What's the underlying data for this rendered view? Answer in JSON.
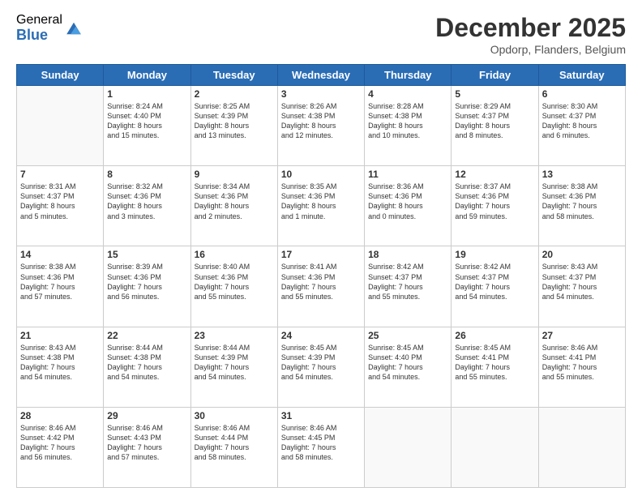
{
  "logo": {
    "general": "General",
    "blue": "Blue"
  },
  "title": "December 2025",
  "location": "Opdorp, Flanders, Belgium",
  "days_of_week": [
    "Sunday",
    "Monday",
    "Tuesday",
    "Wednesday",
    "Thursday",
    "Friday",
    "Saturday"
  ],
  "weeks": [
    [
      {
        "day": "",
        "info": ""
      },
      {
        "day": "1",
        "info": "Sunrise: 8:24 AM\nSunset: 4:40 PM\nDaylight: 8 hours\nand 15 minutes."
      },
      {
        "day": "2",
        "info": "Sunrise: 8:25 AM\nSunset: 4:39 PM\nDaylight: 8 hours\nand 13 minutes."
      },
      {
        "day": "3",
        "info": "Sunrise: 8:26 AM\nSunset: 4:38 PM\nDaylight: 8 hours\nand 12 minutes."
      },
      {
        "day": "4",
        "info": "Sunrise: 8:28 AM\nSunset: 4:38 PM\nDaylight: 8 hours\nand 10 minutes."
      },
      {
        "day": "5",
        "info": "Sunrise: 8:29 AM\nSunset: 4:37 PM\nDaylight: 8 hours\nand 8 minutes."
      },
      {
        "day": "6",
        "info": "Sunrise: 8:30 AM\nSunset: 4:37 PM\nDaylight: 8 hours\nand 6 minutes."
      }
    ],
    [
      {
        "day": "7",
        "info": "Sunrise: 8:31 AM\nSunset: 4:37 PM\nDaylight: 8 hours\nand 5 minutes."
      },
      {
        "day": "8",
        "info": "Sunrise: 8:32 AM\nSunset: 4:36 PM\nDaylight: 8 hours\nand 3 minutes."
      },
      {
        "day": "9",
        "info": "Sunrise: 8:34 AM\nSunset: 4:36 PM\nDaylight: 8 hours\nand 2 minutes."
      },
      {
        "day": "10",
        "info": "Sunrise: 8:35 AM\nSunset: 4:36 PM\nDaylight: 8 hours\nand 1 minute."
      },
      {
        "day": "11",
        "info": "Sunrise: 8:36 AM\nSunset: 4:36 PM\nDaylight: 8 hours\nand 0 minutes."
      },
      {
        "day": "12",
        "info": "Sunrise: 8:37 AM\nSunset: 4:36 PM\nDaylight: 7 hours\nand 59 minutes."
      },
      {
        "day": "13",
        "info": "Sunrise: 8:38 AM\nSunset: 4:36 PM\nDaylight: 7 hours\nand 58 minutes."
      }
    ],
    [
      {
        "day": "14",
        "info": "Sunrise: 8:38 AM\nSunset: 4:36 PM\nDaylight: 7 hours\nand 57 minutes."
      },
      {
        "day": "15",
        "info": "Sunrise: 8:39 AM\nSunset: 4:36 PM\nDaylight: 7 hours\nand 56 minutes."
      },
      {
        "day": "16",
        "info": "Sunrise: 8:40 AM\nSunset: 4:36 PM\nDaylight: 7 hours\nand 55 minutes."
      },
      {
        "day": "17",
        "info": "Sunrise: 8:41 AM\nSunset: 4:36 PM\nDaylight: 7 hours\nand 55 minutes."
      },
      {
        "day": "18",
        "info": "Sunrise: 8:42 AM\nSunset: 4:37 PM\nDaylight: 7 hours\nand 55 minutes."
      },
      {
        "day": "19",
        "info": "Sunrise: 8:42 AM\nSunset: 4:37 PM\nDaylight: 7 hours\nand 54 minutes."
      },
      {
        "day": "20",
        "info": "Sunrise: 8:43 AM\nSunset: 4:37 PM\nDaylight: 7 hours\nand 54 minutes."
      }
    ],
    [
      {
        "day": "21",
        "info": "Sunrise: 8:43 AM\nSunset: 4:38 PM\nDaylight: 7 hours\nand 54 minutes."
      },
      {
        "day": "22",
        "info": "Sunrise: 8:44 AM\nSunset: 4:38 PM\nDaylight: 7 hours\nand 54 minutes."
      },
      {
        "day": "23",
        "info": "Sunrise: 8:44 AM\nSunset: 4:39 PM\nDaylight: 7 hours\nand 54 minutes."
      },
      {
        "day": "24",
        "info": "Sunrise: 8:45 AM\nSunset: 4:39 PM\nDaylight: 7 hours\nand 54 minutes."
      },
      {
        "day": "25",
        "info": "Sunrise: 8:45 AM\nSunset: 4:40 PM\nDaylight: 7 hours\nand 54 minutes."
      },
      {
        "day": "26",
        "info": "Sunrise: 8:45 AM\nSunset: 4:41 PM\nDaylight: 7 hours\nand 55 minutes."
      },
      {
        "day": "27",
        "info": "Sunrise: 8:46 AM\nSunset: 4:41 PM\nDaylight: 7 hours\nand 55 minutes."
      }
    ],
    [
      {
        "day": "28",
        "info": "Sunrise: 8:46 AM\nSunset: 4:42 PM\nDaylight: 7 hours\nand 56 minutes."
      },
      {
        "day": "29",
        "info": "Sunrise: 8:46 AM\nSunset: 4:43 PM\nDaylight: 7 hours\nand 57 minutes."
      },
      {
        "day": "30",
        "info": "Sunrise: 8:46 AM\nSunset: 4:44 PM\nDaylight: 7 hours\nand 58 minutes."
      },
      {
        "day": "31",
        "info": "Sunrise: 8:46 AM\nSunset: 4:45 PM\nDaylight: 7 hours\nand 58 minutes."
      },
      {
        "day": "",
        "info": ""
      },
      {
        "day": "",
        "info": ""
      },
      {
        "day": "",
        "info": ""
      }
    ]
  ]
}
